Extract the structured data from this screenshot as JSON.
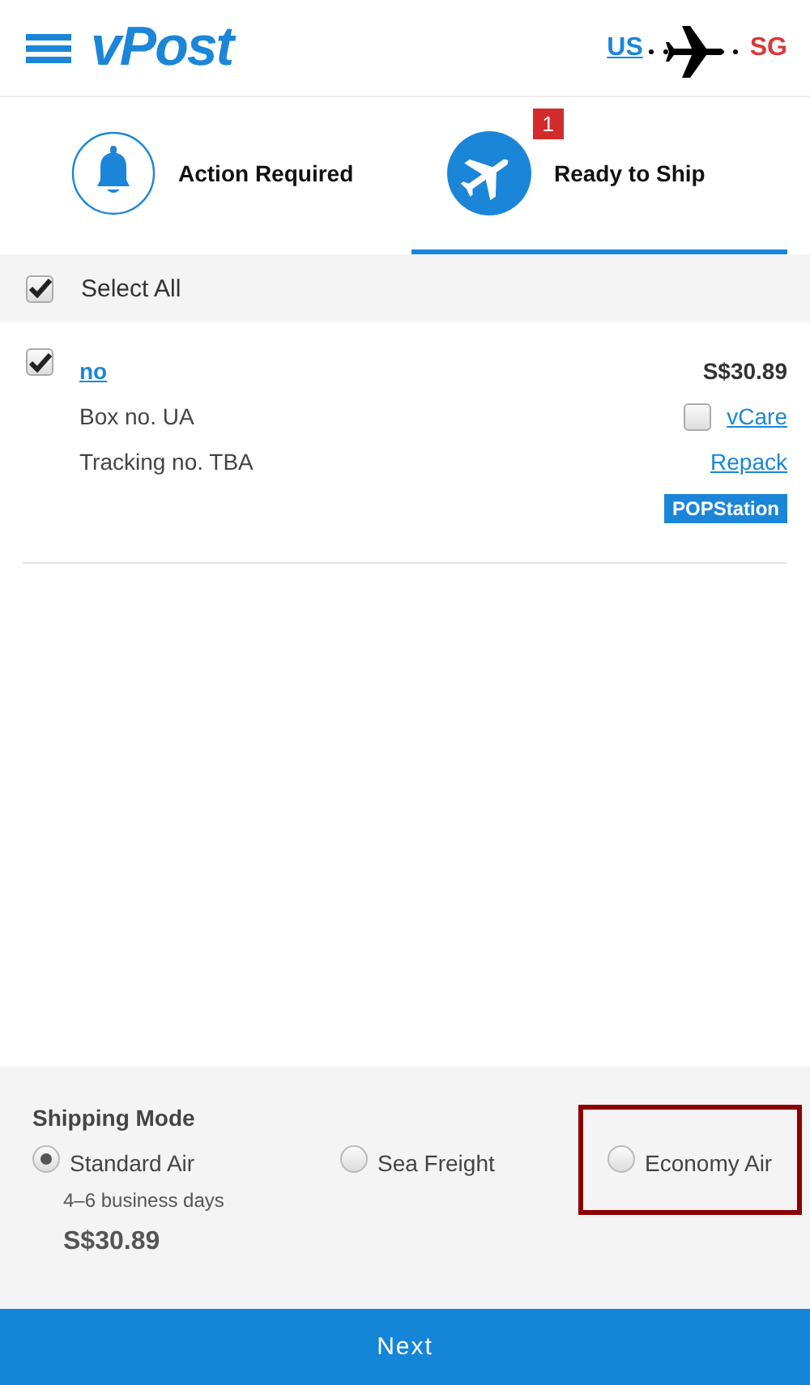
{
  "header": {
    "logo": "vPost",
    "route": {
      "from": "US",
      "to": "SG"
    }
  },
  "tabs": [
    {
      "label": "Action Required",
      "kind": "bell",
      "selected": false
    },
    {
      "label": "Ready to Ship",
      "kind": "plane",
      "selected": true,
      "badge": "1"
    }
  ],
  "select_all": {
    "label": "Select All",
    "checked": true
  },
  "items": [
    {
      "name": "no",
      "checked": true,
      "price": "S$30.89",
      "box": "Box no. UA",
      "tracking": "Tracking no. TBA",
      "vcare": {
        "label": "vCare",
        "checked": false
      },
      "repack": "Repack",
      "tag": "POPStation"
    }
  ],
  "shipping": {
    "title": "Shipping Mode",
    "options": [
      {
        "label": "Standard Air",
        "selected": true,
        "highlighted": false,
        "eta": "4–6 business days",
        "price": "S$30.89"
      },
      {
        "label": "Sea Freight",
        "selected": false,
        "highlighted": false
      },
      {
        "label": "Economy Air",
        "selected": false,
        "highlighted": true
      }
    ]
  },
  "next_button": "Next"
}
